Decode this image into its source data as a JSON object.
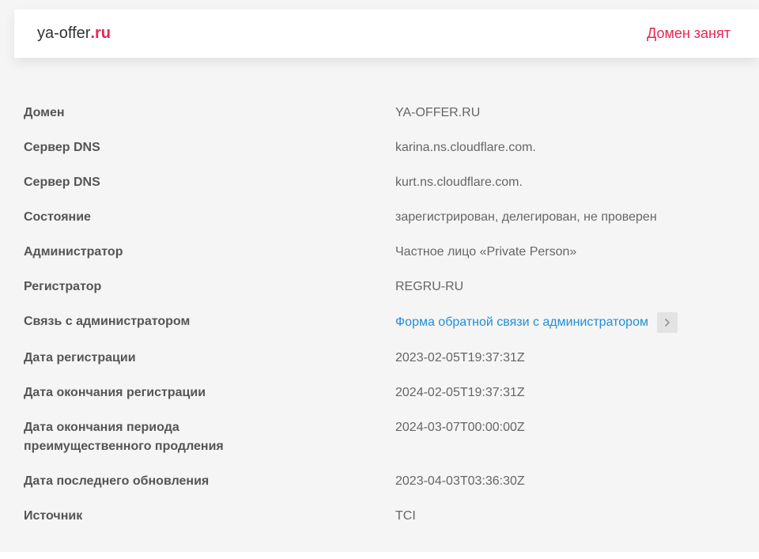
{
  "header": {
    "domain_base": "ya-offer",
    "domain_tld": ".ru",
    "status": "Домен занят"
  },
  "rows": [
    {
      "label": "Домен",
      "value": "YA-OFFER.RU"
    },
    {
      "label": "Сервер DNS",
      "value": "karina.ns.cloudflare.com."
    },
    {
      "label": "Сервер DNS",
      "value": "kurt.ns.cloudflare.com."
    },
    {
      "label": "Состояние",
      "value": "зарегистрирован, делегирован, не проверен"
    },
    {
      "label": "Администратор",
      "value": "Частное лицо «Private Person»"
    },
    {
      "label": "Регистратор",
      "value": "REGRU-RU"
    },
    {
      "label": "Связь с администратором",
      "value": "Форма обратной связи с администратором"
    },
    {
      "label": "Дата регистрации",
      "value": "2023-02-05T19:37:31Z"
    },
    {
      "label": "Дата окончания регистрации",
      "value": "2024-02-05T19:37:31Z"
    },
    {
      "label": "Дата окончания периода преимущественного продления",
      "value": "2024-03-07T00:00:00Z"
    },
    {
      "label": "Дата последнего обновления",
      "value": "2023-04-03T03:36:30Z"
    },
    {
      "label": "Источник",
      "value": "TCI"
    }
  ],
  "icons": {
    "arrow": "chevron-right-icon"
  },
  "colors": {
    "accent": "#e8264f",
    "link": "#1f8fd6",
    "background": "#f5f5f5"
  }
}
